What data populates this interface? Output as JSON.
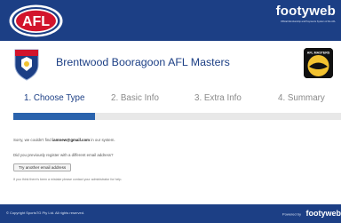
{
  "header": {
    "logo_text": "AFL",
    "brand": "footyweb",
    "tagline": "Official Membership and Payments System of the AFL"
  },
  "club": {
    "name": "Brentwood Booragoon AFL Masters",
    "badge_text": "AFL MASTERS"
  },
  "steps": [
    {
      "label": "1. Choose Type",
      "active": true
    },
    {
      "label": "2. Basic Info",
      "active": false
    },
    {
      "label": "3. Extra Info",
      "active": false
    },
    {
      "label": "4. Summary",
      "active": false
    }
  ],
  "progress": {
    "fraction": 0.25
  },
  "content": {
    "not_found_prefix": "Sorry, we couldn't find ",
    "email": "iamnew@gmail.com",
    "not_found_suffix": " in our system.",
    "question": "Did you previously register with a different email address?",
    "try_button": "Try another email address",
    "help_text": "If you think there's been a mistake please contact your administrator for help."
  },
  "footer": {
    "copyright": "© Copyright SportsTG Pty Ltd. All rights reserved.",
    "powered_label": "Powered by",
    "powered_brand": "footyweb"
  },
  "colors": {
    "brand_navy": "#1c3f85",
    "progress_blue": "#2a63ad",
    "inactive_step": "#8a8a8a"
  }
}
